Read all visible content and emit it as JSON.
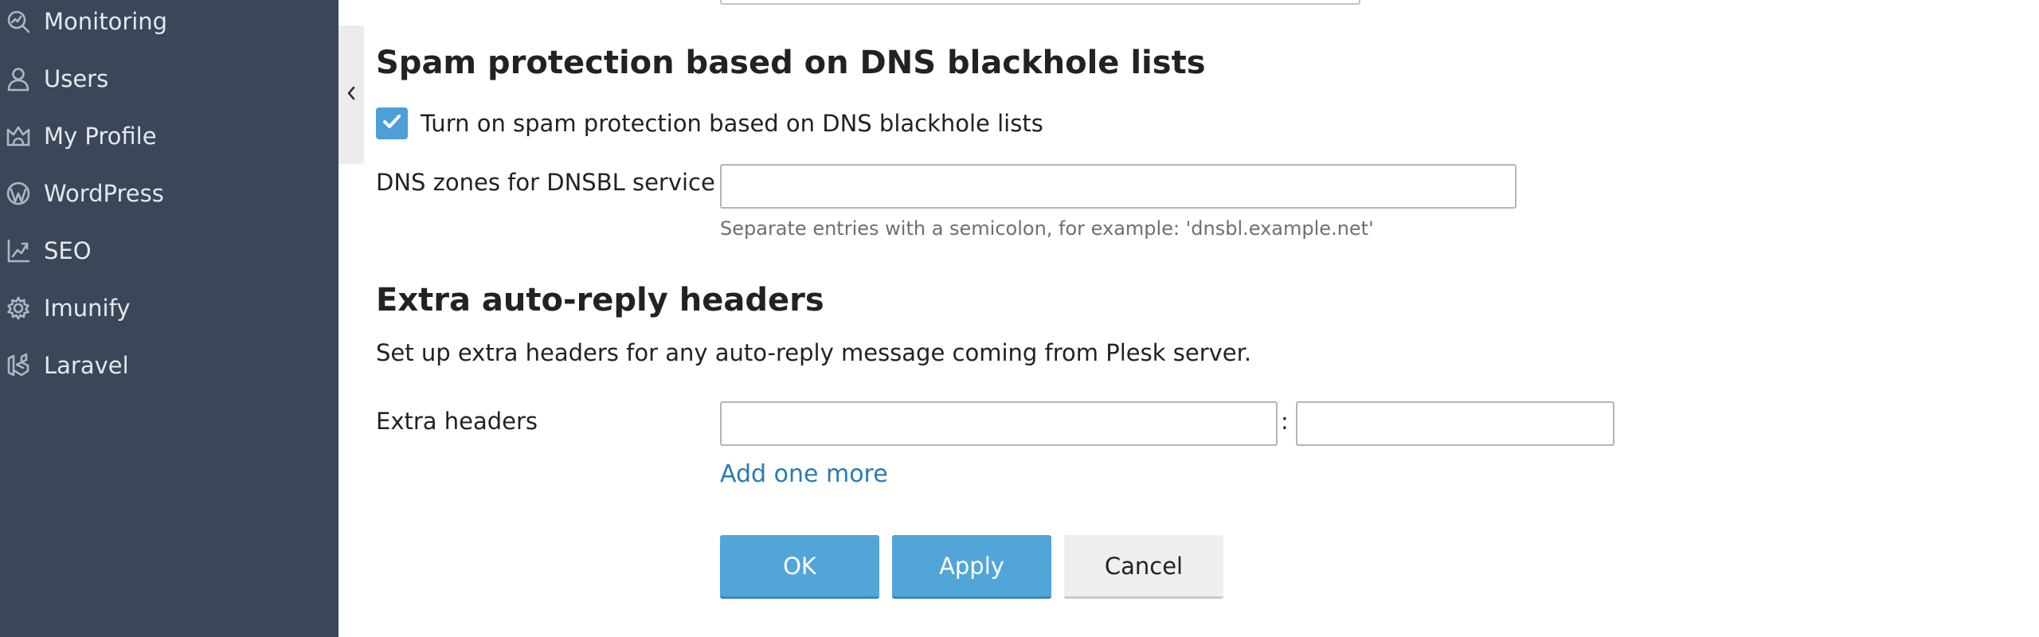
{
  "sidebar": {
    "items": [
      {
        "label": "Monitoring",
        "icon": "monitoring-icon"
      },
      {
        "label": "Users",
        "icon": "user-icon"
      },
      {
        "label": "My Profile",
        "icon": "profile-crown-icon"
      },
      {
        "label": "WordPress",
        "icon": "wordpress-icon"
      },
      {
        "label": "SEO",
        "icon": "seo-chart-icon"
      },
      {
        "label": "Imunify",
        "icon": "imunify-gear-icon"
      },
      {
        "label": "Laravel",
        "icon": "laravel-icon"
      }
    ]
  },
  "collapse_handle": {
    "icon": "chevron-left-icon"
  },
  "dnsbl_section": {
    "heading": "Spam protection based on DNS blackhole lists",
    "checkbox_label": "Turn on spam protection based on DNS blackhole lists",
    "checkbox_checked": true,
    "zones_label": "DNS zones for DNSBL service",
    "zones_value": "",
    "zones_hint": "Separate entries with a semicolon, for example: 'dnsbl.example.net'"
  },
  "autoreply_section": {
    "heading": "Extra auto-reply headers",
    "description": "Set up extra headers for any auto-reply message coming from Plesk server.",
    "headers_label": "Extra headers",
    "header_name_value": "",
    "header_value_value": "",
    "separator": ":",
    "add_link": "Add one more"
  },
  "actions": {
    "ok_label": "OK",
    "apply_label": "Apply",
    "cancel_label": "Cancel"
  },
  "colors": {
    "sidebar_bg": "#3b4658",
    "primary_button": "#52a5d8",
    "link": "#2a7bb3",
    "checkbox": "#4e9fd8"
  }
}
